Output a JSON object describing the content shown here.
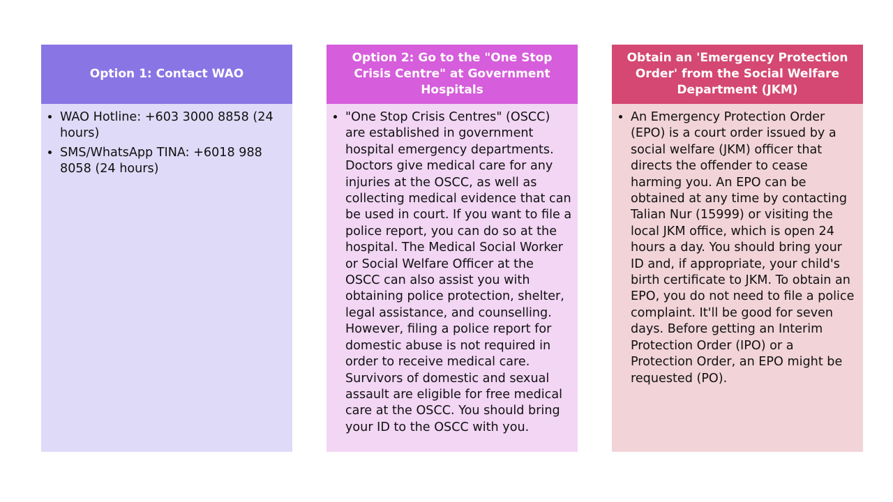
{
  "colors": {
    "card1_header": "#8a75e4",
    "card1_body": "#dedaf7",
    "card2_header": "#d65ddb",
    "card2_body": "#f2d6f4",
    "card3_header": "#d44873",
    "card3_body": "#f1d3d8"
  },
  "cards": [
    {
      "title": "Option 1: Contact WAO",
      "bullets": [
        "WAO Hotline: +603 3000 8858 (24 hours)",
        "SMS/WhatsApp TINA: +6018 988 8058 (24 hours)"
      ]
    },
    {
      "title": "Option 2: Go to the \"One Stop Crisis Centre\" at Government Hospitals",
      "bullets": [
        "\"One Stop Crisis Centres\" (OSCC) are established in government hospital emergency departments. Doctors give medical care for any injuries at the OSCC, as well as collecting medical evidence that can be used in court. If you want to file a police report, you can do so at the hospital. The Medical Social Worker or Social Welfare Officer at the OSCC can also assist you with obtaining police protection, shelter, legal assistance, and counselling. However, filing a police report for domestic abuse is not required in order to receive medical care. Survivors of domestic and sexual assault are eligible for free medical care at the OSCC. You should bring your ID to the OSCC with you."
      ]
    },
    {
      "title": "Obtain an 'Emergency Protection Order' from the Social Welfare Department (JKM)",
      "bullets": [
        "An Emergency Protection Order (EPO) is a court order issued by a social welfare (JKM) officer that directs the offender to cease harming you. An EPO can be obtained at any time by contacting Talian Nur (15999) or visiting the local JKM office, which is open 24 hours a day. You should bring your ID and, if appropriate, your child's birth certificate to JKM. To obtain an EPO, you do not need to file a police complaint. It'll be good for seven days. Before getting an Interim Protection Order (IPO) or a Protection Order, an EPO might be requested (PO)."
      ]
    }
  ]
}
